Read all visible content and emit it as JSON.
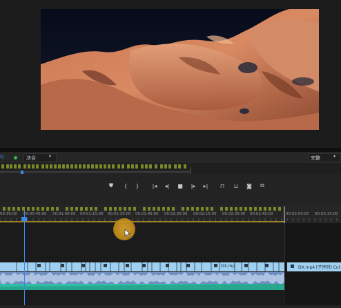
{
  "top_bar": {
    "left_dropdown_label": "Q",
    "sequence_dropdown": "决合",
    "right_dropdown": "完整"
  },
  "timeline": {
    "timecodes": [
      "00:30:00",
      "00:00:45:00",
      "00:01:00:00",
      "00:01:15:00",
      "00:01:30:00",
      "00:01:45:00",
      "00:02:00:00",
      "00:02:15:00",
      "00:02:30:00",
      "00:02:45:00",
      "00:03:00:00",
      "00:03:15:00"
    ]
  },
  "clips": {
    "main_clip_label": "DX.mp",
    "next_clip_label": "DX.mp4 [子序列] Cut"
  },
  "colors": {
    "accent_blue": "#3d89e8",
    "clip_blue": "#9fd0f0",
    "audio_teal": "#2fbfa8",
    "marker_green": "#7a8a2a",
    "timeline_line": "#c9a227"
  },
  "icons": [
    "marker-icon",
    "in-point-icon",
    "out-point-icon",
    "go-to-in-icon",
    "step-back-icon",
    "stop-icon",
    "play-icon",
    "step-forward-icon",
    "go-to-out-icon",
    "lift-icon",
    "extract-icon",
    "export-frame-icon",
    "compare-icon"
  ]
}
